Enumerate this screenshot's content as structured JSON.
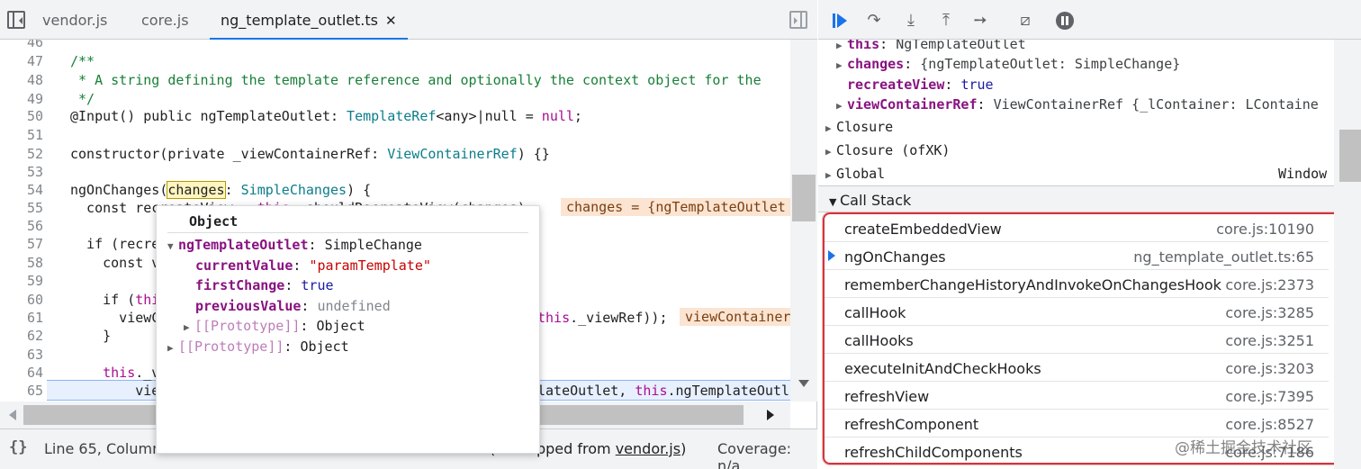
{
  "editor": {
    "tabs": [
      {
        "label": "vendor.js"
      },
      {
        "label": "core.js"
      },
      {
        "label": "ng_template_outlet.ts",
        "close": "✕"
      }
    ],
    "lines": [
      {
        "n": "46"
      },
      {
        "n": "47"
      },
      {
        "n": "48"
      },
      {
        "n": "49"
      },
      {
        "n": "50"
      },
      {
        "n": "51"
      },
      {
        "n": "52"
      },
      {
        "n": "53"
      },
      {
        "n": "54"
      },
      {
        "n": "55"
      },
      {
        "n": "56"
      },
      {
        "n": "57"
      },
      {
        "n": "58"
      },
      {
        "n": "59"
      },
      {
        "n": "60"
      },
      {
        "n": "61"
      },
      {
        "n": "62"
      },
      {
        "n": "63"
      },
      {
        "n": "64"
      },
      {
        "n": "65"
      }
    ],
    "code": {
      "l47": "/**",
      "l48": " * A string defining the template reference and optionally the context object for the",
      "l49": " */",
      "l50a": "@Input() public ngTemplateOutlet: ",
      "l50b": "TemplateRef",
      "l50c": "<any>|null = ",
      "l50d": "null",
      "l50e": ";",
      "l52a": "constructor(private _viewContainerRef: ",
      "l52b": "ViewContainerRef",
      "l52c": ") {}",
      "l54a": "ngOnChanges(",
      "l54b": "changes",
      "l54c": ": ",
      "l54d": "SimpleChanges",
      "l54e": ") {",
      "l55a": "  const recreateView = ",
      "l55b": "this",
      "l55c": "._shouldRecreateView(changes);",
      "l57a": "  if (recre",
      "l58a": "    const v",
      "l60a": "    if (",
      "l60b": "thi",
      "l61a": "      viewC",
      "l61b": "this",
      "l61c": "._viewRef));",
      "l62a": "    }",
      "l64a": "    ",
      "l64b": "this",
      "l64c": "._v",
      "l65a": "        vie",
      "l65b": "lateOutlet, ",
      "l65c": "this",
      "l65d": ".ngTemplateOutl"
    },
    "badges": {
      "line55": "changes = {ngTemplateOutlet",
      "line61": "viewContainer"
    }
  },
  "popover": {
    "title": "Object",
    "ngTemplateOutlet_key": "ngTemplateOutlet",
    "ngTemplateOutlet_val": "SimpleChange",
    "currentValue_key": "currentValue",
    "currentValue_val": "\"paramTemplate\"",
    "firstChange_key": "firstChange",
    "firstChange_val": "true",
    "previousValue_key": "previousValue",
    "previousValue_val": "undefined",
    "proto_inner_key": "[[Prototype]]",
    "proto_inner_val": "Object",
    "proto_outer_key": "[[Prototype]]",
    "proto_outer_val": "Object"
  },
  "statusbar": {
    "braces": "{}",
    "position": "Line 65, Column",
    "mapped_prefix": "(",
    "mapped_mid": "mapped from ",
    "mapped_link": "vendor.js",
    "mapped_suffix": ")",
    "coverage": "Coverage: n/a"
  },
  "scope": {
    "this_key": "this",
    "this_val": "NgTemplateOutlet",
    "changes_key": "changes",
    "changes_val": "{ngTemplateOutlet: SimpleChange}",
    "recreateView_key": "recreateView",
    "recreateView_val": "true",
    "vcr_key": "viewContainerRef",
    "vcr_val": "ViewContainerRef {_lContainer: LContaine",
    "closure1": "Closure",
    "closure2": "Closure (ofXK)",
    "global": "Global",
    "global_val": "Window"
  },
  "callstack": {
    "title": "Call Stack",
    "frames": [
      {
        "fn": "createEmbeddedView",
        "loc": "core.js:10190"
      },
      {
        "fn": "ngOnChanges",
        "loc": "ng_template_outlet.ts:65",
        "current": true
      },
      {
        "fn": "rememberChangeHistoryAndInvokeOnChangesHook",
        "loc": "core.js:2373"
      },
      {
        "fn": "callHook",
        "loc": "core.js:3285"
      },
      {
        "fn": "callHooks",
        "loc": "core.js:3251"
      },
      {
        "fn": "executeInitAndCheckHooks",
        "loc": "core.js:3203"
      },
      {
        "fn": "refreshView",
        "loc": "core.js:7395"
      },
      {
        "fn": "refreshComponent",
        "loc": "core.js:8527"
      },
      {
        "fn": "refreshChildComponents",
        "loc": "core.js:7186"
      }
    ]
  },
  "watermark": "@稀土掘金技术社区",
  "colors": {
    "accent": "#1a73e8",
    "highlight_frame": "#d0363e"
  }
}
